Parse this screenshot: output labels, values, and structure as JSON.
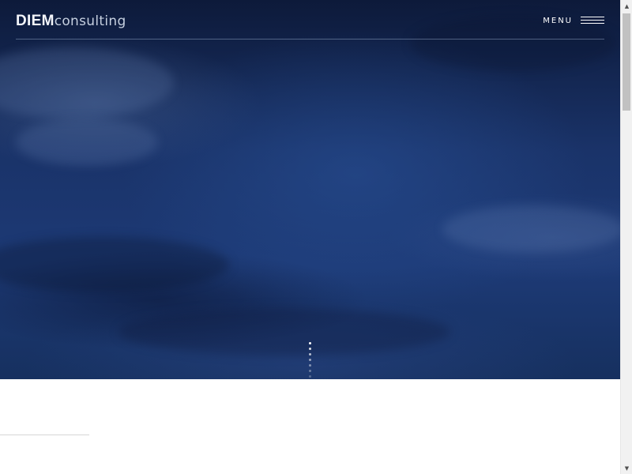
{
  "header": {
    "logo_primary": "DIEM",
    "logo_secondary": "consulting",
    "menu_label": "MENU"
  },
  "hero": {
    "slide_indicator_count": 7
  },
  "scrollbar": {
    "up_arrow": "▲",
    "down_arrow": "▼"
  },
  "colors": {
    "hero_dark": "#0d1a3a",
    "hero_mid": "#1d3a76",
    "text_white": "#ffffff",
    "divider": "#d6d6d6"
  }
}
